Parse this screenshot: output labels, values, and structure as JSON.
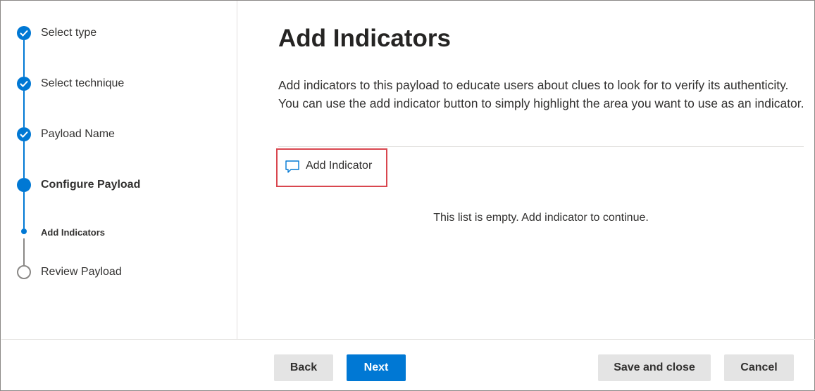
{
  "stepper": {
    "steps": [
      {
        "label": "Select type",
        "state": "completed"
      },
      {
        "label": "Select technique",
        "state": "completed"
      },
      {
        "label": "Payload Name",
        "state": "completed"
      },
      {
        "label": "Configure Payload",
        "state": "current"
      },
      {
        "label": "Add Indicators",
        "state": "current-substep"
      },
      {
        "label": "Review Payload",
        "state": "not-started"
      }
    ]
  },
  "main": {
    "title": "Add Indicators",
    "description": "Add indicators to this payload to educate users about clues to look for to verify its authenticity. You can use the add indicator button to simply highlight the area you want to use as an indicator.",
    "add_indicator": {
      "label": "Add Indicator",
      "icon": "comment-icon"
    },
    "empty_message": "This list is empty. Add indicator to continue."
  },
  "footer": {
    "back_label": "Back",
    "next_label": "Next",
    "save_label": "Save and close",
    "cancel_label": "Cancel"
  },
  "colors": {
    "accent": "#0078d4",
    "highlight_border": "#d9474f",
    "secondary_button": "#e4e4e4"
  }
}
